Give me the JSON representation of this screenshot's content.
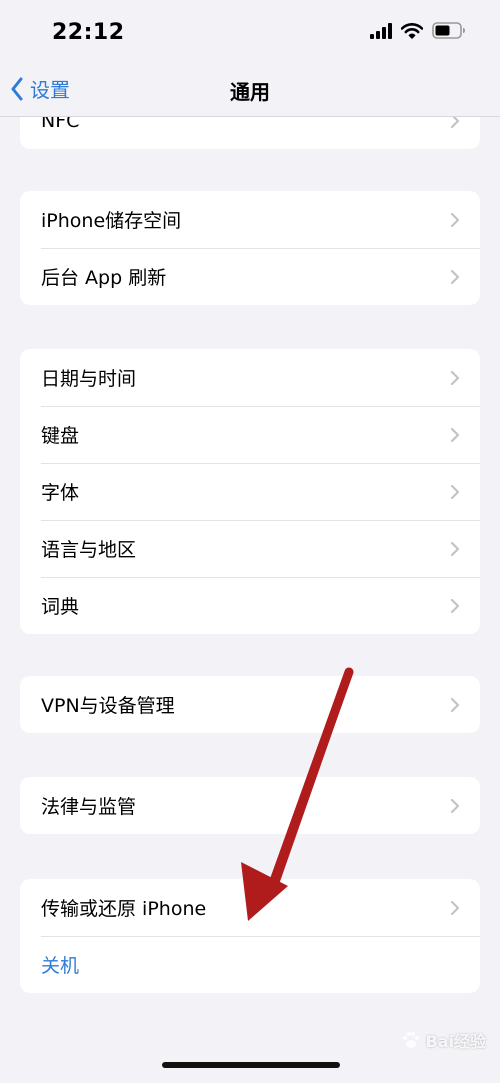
{
  "status_bar": {
    "time": "22:12"
  },
  "nav": {
    "back_label": "设置",
    "title": "通用"
  },
  "groups": {
    "top_partial": {
      "items": [
        {
          "label": "NFC"
        }
      ]
    },
    "storage": {
      "items": [
        {
          "label": "iPhone储存空间"
        },
        {
          "label": "后台 App 刷新"
        }
      ]
    },
    "regional": {
      "items": [
        {
          "label": "日期与时间"
        },
        {
          "label": "键盘"
        },
        {
          "label": "字体"
        },
        {
          "label": "语言与地区"
        },
        {
          "label": "词典"
        }
      ]
    },
    "vpn": {
      "items": [
        {
          "label": "VPN与设备管理"
        }
      ]
    },
    "legal": {
      "items": [
        {
          "label": "法律与监管"
        }
      ]
    },
    "reset": {
      "items": [
        {
          "label": "传输或还原 iPhone"
        },
        {
          "label": "关机"
        }
      ]
    }
  },
  "watermark": {
    "text": "Bai经验"
  },
  "colors": {
    "accent": "#2f7bd9",
    "background": "#f2f2f7",
    "arrow": "#b01c1c"
  }
}
